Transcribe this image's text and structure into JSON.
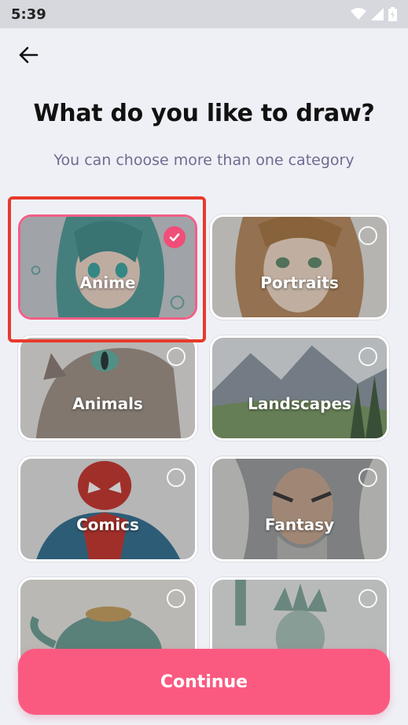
{
  "status_bar": {
    "time": "5:39",
    "icons": [
      "wifi-icon",
      "signal-icon",
      "battery-icon"
    ]
  },
  "header": {
    "back_icon": "arrow-left-icon",
    "title": "What do you like to draw?",
    "subtitle": "You can choose more than one category"
  },
  "categories": [
    {
      "label": "Anime",
      "selected": true
    },
    {
      "label": "Portraits",
      "selected": false
    },
    {
      "label": "Animals",
      "selected": false
    },
    {
      "label": "Landscapes",
      "selected": false
    },
    {
      "label": "Comics",
      "selected": false
    },
    {
      "label": "Fantasy",
      "selected": false
    },
    {
      "label": "",
      "selected": false
    },
    {
      "label": "",
      "selected": false
    }
  ],
  "footer": {
    "continue_label": "Continue"
  },
  "colors": {
    "accent": "#fb5a80",
    "selected_border": "#f25e86",
    "highlight_box": "#e83a2b",
    "background": "#eff0f6"
  }
}
